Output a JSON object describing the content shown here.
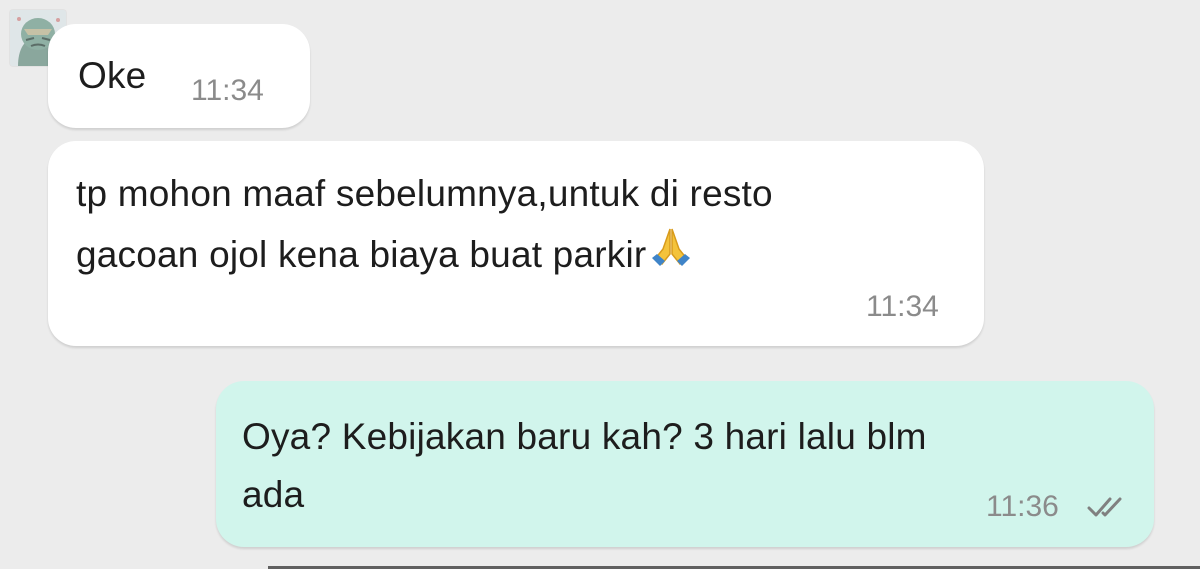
{
  "avatar": {
    "icon": "cartoon-avatar-icon"
  },
  "messages": [
    {
      "direction": "incoming",
      "text": "Oke",
      "time": "11:34"
    },
    {
      "direction": "incoming",
      "text_line1": "tp mohon maaf sebelumnya,untuk di resto",
      "text_line2": "gacoan ojol kena biaya buat parkir",
      "emoji": "folded-hands-icon",
      "time": "11:34"
    },
    {
      "direction": "outgoing",
      "text_line1": "Oya? Kebijakan baru kah? 3 hari lalu blm",
      "text_line2": "ada",
      "time": "11:36",
      "status_icon": "double-check-icon"
    }
  ],
  "colors": {
    "background": "#ececec",
    "incoming_bubble": "#ffffff",
    "outgoing_bubble": "#d1f5ec",
    "timestamp": "#8b8b8b"
  }
}
